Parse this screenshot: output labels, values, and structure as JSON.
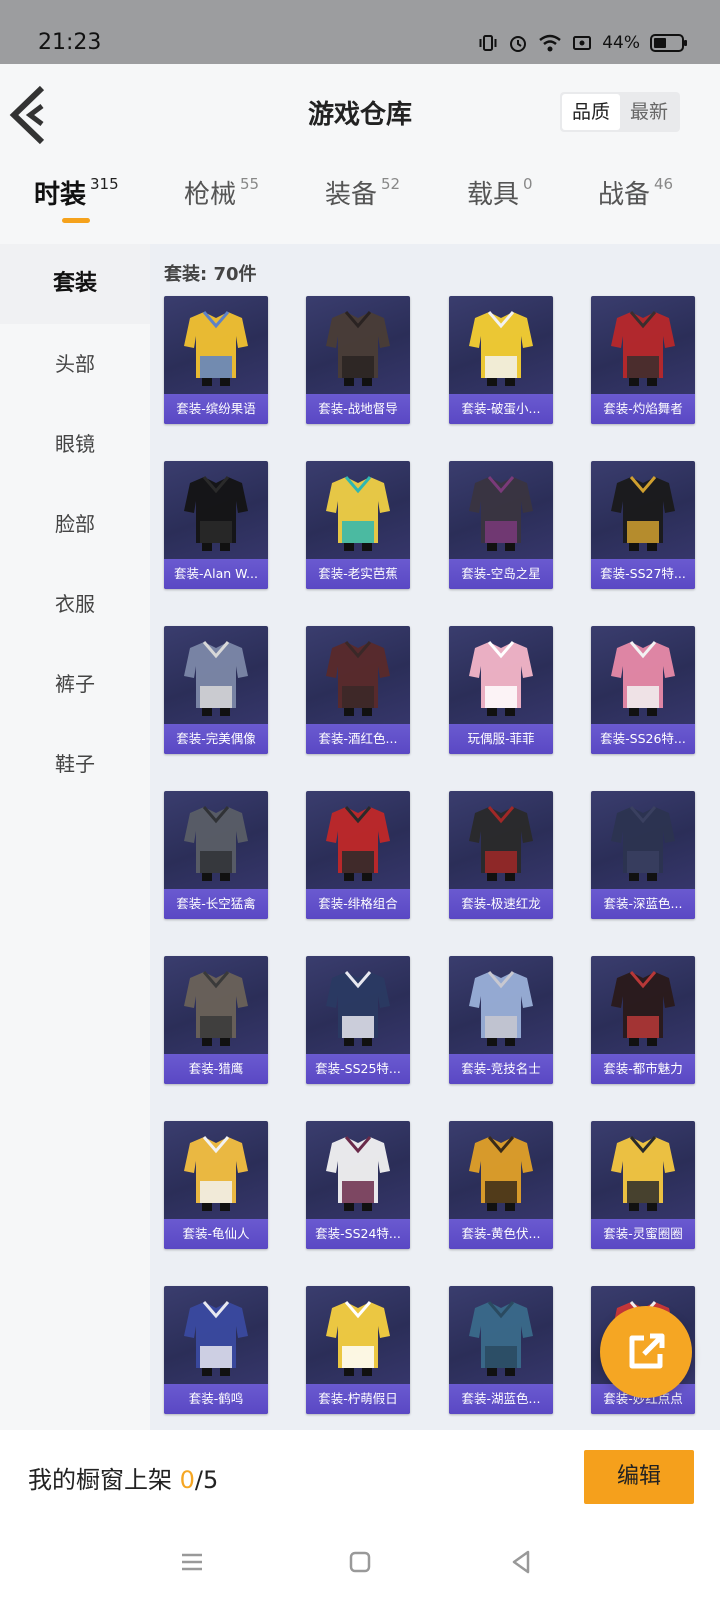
{
  "status_bar": {
    "time": "21:23",
    "battery": "44%"
  },
  "header": {
    "title": "游戏仓库",
    "sort_options": [
      "品质",
      "最新"
    ]
  },
  "tabs": [
    {
      "label": "时装",
      "count": "315"
    },
    {
      "label": "枪械",
      "count": "55"
    },
    {
      "label": "装备",
      "count": "52"
    },
    {
      "label": "载具",
      "count": "0"
    },
    {
      "label": "战备",
      "count": "46"
    }
  ],
  "sidebar": {
    "items": [
      {
        "label": "套装"
      },
      {
        "label": "头部"
      },
      {
        "label": "眼镜"
      },
      {
        "label": "脸部"
      },
      {
        "label": "衣服"
      },
      {
        "label": "裤子"
      },
      {
        "label": "鞋子"
      }
    ]
  },
  "content": {
    "section_label": "套装: 70件",
    "items": [
      {
        "name": "套装-缤纷果语"
      },
      {
        "name": "套装-战地督导"
      },
      {
        "name": "套装-破蛋小..."
      },
      {
        "name": "套装-灼焰舞者"
      },
      {
        "name": "套装-Alan W..."
      },
      {
        "name": "套装-老实芭蕉"
      },
      {
        "name": "套装-空岛之星"
      },
      {
        "name": "套装-SS27特..."
      },
      {
        "name": "套装-完美偶像"
      },
      {
        "name": "套装-酒红色..."
      },
      {
        "name": "玩偶服-菲菲"
      },
      {
        "name": "套装-SS26特..."
      },
      {
        "name": "套装-长空猛禽"
      },
      {
        "name": "套装-绯格组合"
      },
      {
        "name": "套装-极速红龙"
      },
      {
        "name": "套装-深蓝色..."
      },
      {
        "name": "套装-猎鹰"
      },
      {
        "name": "套装-SS25特..."
      },
      {
        "name": "套装-竞技名士"
      },
      {
        "name": "套装-都市魅力"
      },
      {
        "name": "套装-龟仙人"
      },
      {
        "name": "套装-SS24特..."
      },
      {
        "name": "套装-黄色伏..."
      },
      {
        "name": "套装-灵蜜圈圈"
      },
      {
        "name": "套装-鹤鸣"
      },
      {
        "name": "套装-柠萌假日"
      },
      {
        "name": "套装-湖蓝色..."
      },
      {
        "name": "套装-妙红点点"
      }
    ]
  },
  "bottom_bar": {
    "showcase_prefix": "我的橱窗上架 ",
    "showcase_current": "0",
    "showcase_total": "/5",
    "edit_label": "编辑"
  },
  "colors": {
    "accent": "#f5a623",
    "card_label": "#5a48c4",
    "card_bg": "#2f3160"
  }
}
